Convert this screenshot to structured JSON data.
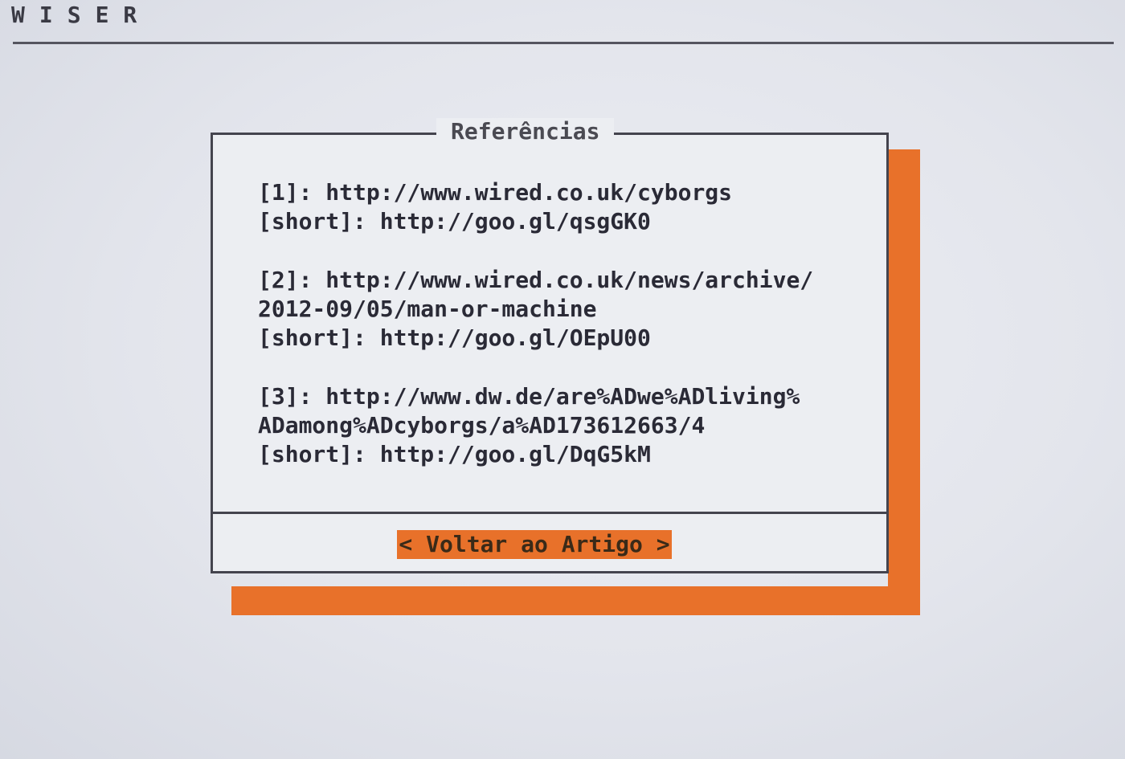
{
  "app": {
    "title": "WISER"
  },
  "dialog": {
    "title": "Referências",
    "references": [
      {
        "lines": [
          "[1]: http://www.wired.co.uk/cyborgs",
          "[short]: http://goo.gl/qsgGK0"
        ]
      },
      {
        "lines": [
          "[2]: http://www.wired.co.uk/news/archive/",
          "2012-09/05/man-or-machine",
          "[short]: http://goo.gl/OEpU00"
        ]
      },
      {
        "lines": [
          "[3]: http://www.dw.de/are%ADwe%ADliving%",
          "ADamong%ADcyborgs/a%AD17361266З/4",
          "[short]: http://goo.gl/DqG5kM"
        ]
      }
    ],
    "back_button": {
      "label": "< Voltar ao Artigo >"
    }
  },
  "colors": {
    "accent": "#e8712a",
    "border": "#44444e",
    "background": "#eceef2"
  }
}
